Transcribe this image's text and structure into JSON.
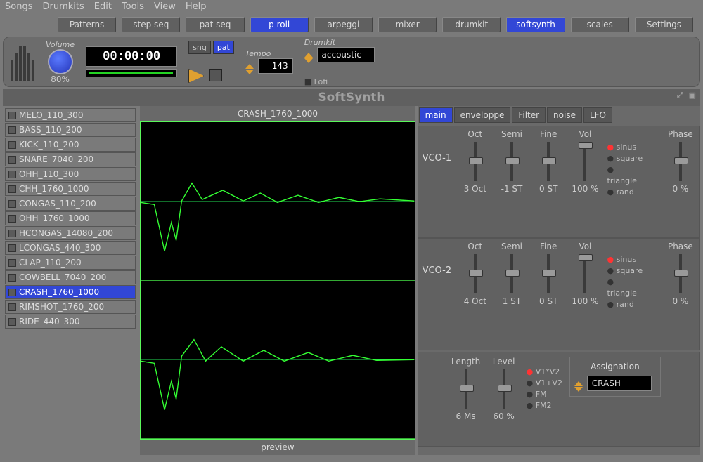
{
  "menu": [
    "Songs",
    "Drumkits",
    "Edit",
    "Tools",
    "View",
    "Help"
  ],
  "topButtons": [
    {
      "label": "Patterns",
      "active": false
    },
    {
      "label": "step seq",
      "active": false
    },
    {
      "label": "pat seq",
      "active": false
    },
    {
      "label": "p roll",
      "active": true
    },
    {
      "label": "arpeggi",
      "active": false
    },
    {
      "label": "mixer",
      "active": false
    },
    {
      "label": "drumkit",
      "active": false
    },
    {
      "label": "softsynth",
      "active": true
    },
    {
      "label": "scales",
      "active": false
    },
    {
      "label": "Settings",
      "active": false
    }
  ],
  "transport": {
    "volume_label": "Volume",
    "volume_value": "80%",
    "time": "00:00:00",
    "sng": "sng",
    "pat": "pat",
    "tempo_label": "Tempo",
    "tempo_value": "143",
    "drumkit_label": "Drumkit",
    "drumkit_value": "accoustic",
    "lofi": "Lofi"
  },
  "panel_title": "SoftSynth",
  "patches": [
    "MELO_110_300",
    "BASS_110_200",
    "KICK_110_200",
    "SNARE_7040_200",
    "OHH_110_300",
    "CHH_1760_1000",
    "CONGAS_110_200",
    "OHH_1760_1000",
    "HCONGAS_14080_200",
    "LCONGAS_440_300",
    "CLAP_110_200",
    "COWBELL_7040_200",
    "CRASH_1760_1000",
    "RIMSHOT_1760_200",
    "RIDE_440_300"
  ],
  "selected_patch": "CRASH_1760_1000",
  "preview_label": "preview",
  "tabs": [
    "main",
    "enveloppe",
    "Filter",
    "noise",
    "LFO"
  ],
  "active_tab": "main",
  "vco": [
    {
      "name": "VCO-1",
      "oct": "3 Oct",
      "semi": "-1 ST",
      "fine": "0 ST",
      "vol": "100 %",
      "phase": "0 %",
      "wave_sel": "sinus"
    },
    {
      "name": "VCO-2",
      "oct": "4 Oct",
      "semi": "1 ST",
      "fine": "0 ST",
      "vol": "100 %",
      "phase": "0 %",
      "wave_sel": "sinus"
    }
  ],
  "slider_labels": {
    "oct": "Oct",
    "semi": "Semi",
    "fine": "Fine",
    "vol": "Vol",
    "phase": "Phase"
  },
  "wave_options": [
    "sinus",
    "square",
    "triangle",
    "rand"
  ],
  "mix": {
    "length_label": "Length",
    "length_value": "6 Ms",
    "level_label": "Level",
    "level_value": "60 %",
    "modes": [
      "V1*V2",
      "V1+V2",
      "FM",
      "FM2"
    ],
    "mode_sel": "V1*V2",
    "assign_title": "Assignation",
    "assign_value": "CRASH"
  }
}
